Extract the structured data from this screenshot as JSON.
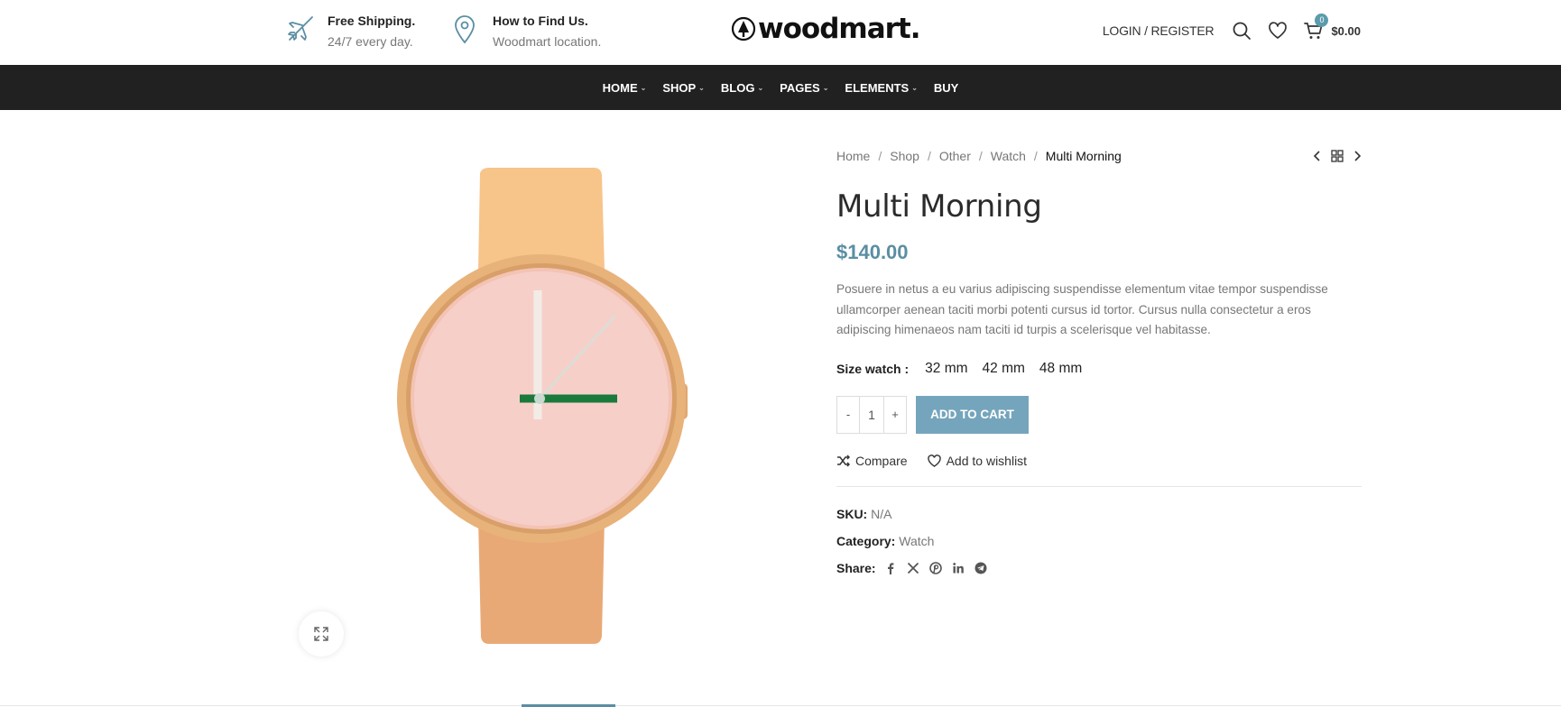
{
  "header": {
    "info": [
      {
        "icon": "airplane-icon",
        "title": "Free Shipping.",
        "subtitle": "24/7 every day."
      },
      {
        "icon": "location-pin-icon",
        "title": "How to Find Us.",
        "subtitle": "Woodmart location."
      }
    ],
    "logo_text": "woodmart.",
    "login_label": "LOGIN / REGISTER",
    "cart_count": "0",
    "cart_total": "$0.00"
  },
  "nav": {
    "items": [
      {
        "label": "HOME",
        "has_dropdown": true
      },
      {
        "label": "SHOP",
        "has_dropdown": true
      },
      {
        "label": "BLOG",
        "has_dropdown": true
      },
      {
        "label": "PAGES",
        "has_dropdown": true
      },
      {
        "label": "ELEMENTS",
        "has_dropdown": true
      },
      {
        "label": "BUY",
        "has_dropdown": false
      }
    ]
  },
  "breadcrumb": {
    "items": [
      "Home",
      "Shop",
      "Other",
      "Watch"
    ],
    "current": "Multi Morning",
    "separator": "/"
  },
  "product": {
    "title": "Multi Morning",
    "price": "$140.00",
    "description": "Posuere in netus a eu varius adipiscing suspendisse elementum vitae tempor suspendisse ullamcorper aenean taciti morbi potenti cursus id tortor. Cursus nulla consectetur a eros adipiscing himenaeos nam taciti id turpis a scelerisque vel habitasse.",
    "size_label": "Size watch",
    "sizes": [
      "32 mm",
      "42 mm",
      "48 mm"
    ],
    "qty_minus": "-",
    "qty_value": "1",
    "qty_plus": "+",
    "add_to_cart": "ADD TO CART",
    "compare_label": "Compare",
    "wishlist_label": "Add to wishlist",
    "sku_label": "SKU:",
    "sku_value": "N/A",
    "category_label": "Category:",
    "category_value": "Watch",
    "share_label": "Share:",
    "share_icons": [
      "facebook-icon",
      "x-twitter-icon",
      "pinterest-icon",
      "linkedin-icon",
      "telegram-icon"
    ]
  },
  "colors": {
    "accent": "#5b8ea3",
    "button": "#75a5bc",
    "navbar": "#212121"
  }
}
